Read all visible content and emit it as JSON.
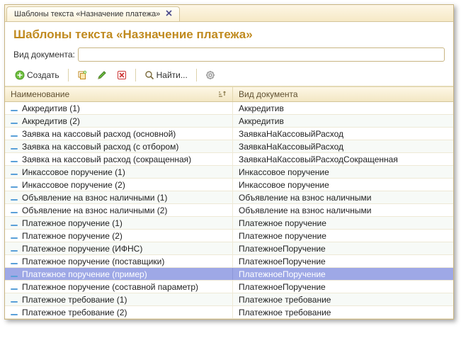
{
  "tab": {
    "title": "Шаблоны текста «Назначение платежа»"
  },
  "page_title": "Шаблоны текста «Назначение платежа»",
  "filter": {
    "label": "Вид документа:",
    "value": ""
  },
  "toolbar": {
    "create": "Создать",
    "find": "Найти..."
  },
  "columns": {
    "name": "Наименование",
    "doc": "Вид документа"
  },
  "rows": [
    {
      "name": "Аккредитив (1)",
      "doc": "Аккредитив",
      "selected": false
    },
    {
      "name": "Аккредитив (2)",
      "doc": "Аккредитив",
      "selected": false
    },
    {
      "name": "Заявка на кассовый расход (основной)",
      "doc": "ЗаявкаНаКассовыйРасход",
      "selected": false
    },
    {
      "name": "Заявка на кассовый расход (с отбором)",
      "doc": "ЗаявкаНаКассовыйРасход",
      "selected": false
    },
    {
      "name": "Заявка на кассовый расход (сокращенная)",
      "doc": "ЗаявкаНаКассовыйРасходСокращенная",
      "selected": false
    },
    {
      "name": "Инкассовое поручение (1)",
      "doc": "Инкассовое поручение",
      "selected": false
    },
    {
      "name": "Инкассовое поручение (2)",
      "doc": "Инкассовое поручение",
      "selected": false
    },
    {
      "name": "Объявление на взнос наличными (1)",
      "doc": "Объявление на взнос наличными",
      "selected": false
    },
    {
      "name": "Объявление на взнос наличными (2)",
      "doc": "Объявление на взнос наличными",
      "selected": false
    },
    {
      "name": "Платежное поручение (1)",
      "doc": "Платежное поручение",
      "selected": false
    },
    {
      "name": "Платежное поручение (2)",
      "doc": "Платежное поручение",
      "selected": false
    },
    {
      "name": "Платежное поручение (ИФНС)",
      "doc": "ПлатежноеПоручение",
      "selected": false
    },
    {
      "name": "Платежное поручение (поставщики)",
      "doc": "ПлатежноеПоручение",
      "selected": false
    },
    {
      "name": "Платежное поручение (пример)",
      "doc": "ПлатежноеПоручение",
      "selected": true
    },
    {
      "name": "Платежное поручение (составной параметр)",
      "doc": "ПлатежноеПоручение",
      "selected": false
    },
    {
      "name": "Платежное требование (1)",
      "doc": "Платежное требование",
      "selected": false
    },
    {
      "name": "Платежное требование (2)",
      "doc": "Платежное требование",
      "selected": false
    }
  ]
}
